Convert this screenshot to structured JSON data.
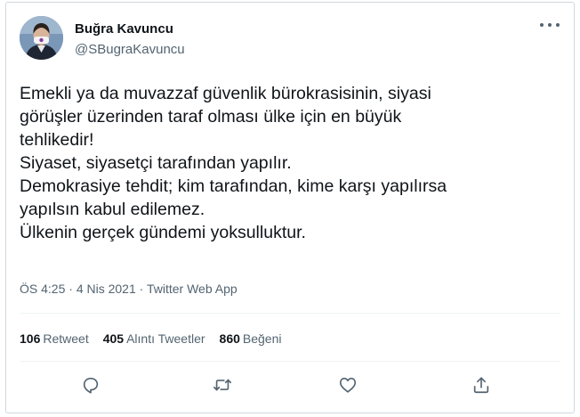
{
  "tweet": {
    "author": {
      "name": "Buğra Kavuncu",
      "handle": "@SBugraKavuncu"
    },
    "text_lines": [
      "Emekli ya da muvazzaf güvenlik bürokrasisinin, siyasi",
      "görüşler üzerinden taraf olması ülke için en büyük",
      "tehlikedir!",
      "Siyaset, siyasetçi tarafından yapılır.",
      "Demokrasiye tehdit; kim tarafından, kime karşı yapılırsa",
      "yapılsın kabul edilemez.",
      "Ülkenin gerçek gündemi yoksulluktur."
    ],
    "meta": {
      "time": "ÖS 4:25",
      "date": "4 Nis 2021",
      "dot": "·",
      "source": "Twitter Web App"
    },
    "stats": {
      "retweets": {
        "count": "106",
        "label": "Retweet"
      },
      "quotes": {
        "count": "405",
        "label": "Alıntı Tweetler"
      },
      "likes": {
        "count": "860",
        "label": "Beğeni"
      }
    },
    "actions": [
      "reply-icon",
      "retweet-icon",
      "like-icon",
      "share-icon"
    ],
    "colors": {
      "text": "#0f1419",
      "secondary": "#536471",
      "border": "#cfd9de",
      "divider": "#eff3f4"
    }
  }
}
